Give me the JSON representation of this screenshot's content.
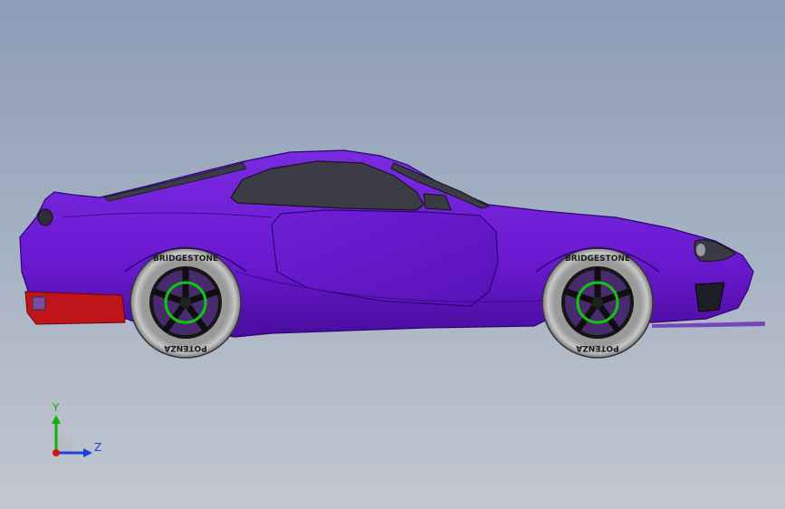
{
  "viewport": {
    "background_top": "#8d9db6",
    "background_bottom": "#c2c7d0"
  },
  "model": {
    "body_color": "#6a19d0",
    "body_shadow_color": "#4a0c9e",
    "glass_color": "#3c3c46",
    "bumper_color": "#c0141b",
    "tire_color": "#b8b8b8",
    "rim_color": "#161616",
    "brake_caliper_color": "#14c414",
    "tire_brand_top": "BRIDGESTONE",
    "tire_brand_bottom": "POTENZA"
  },
  "triad": {
    "y_label": "Y",
    "z_label": "Z",
    "y_color": "#0fb30f",
    "z_color": "#1f3fdc",
    "x_color": "#d41414",
    "icon": "axis-triad-icon"
  }
}
